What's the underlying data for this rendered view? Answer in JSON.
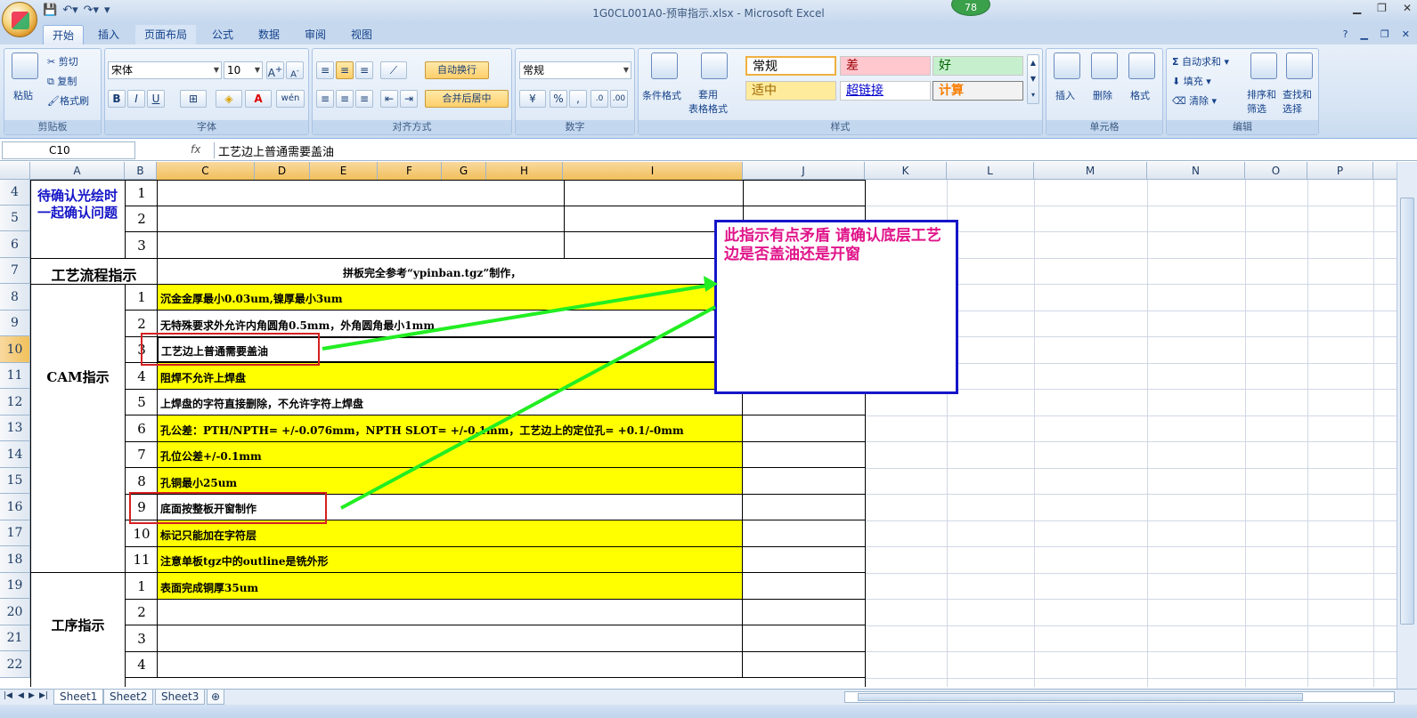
{
  "window": {
    "title": "1G0CL001A0-预审指示.xlsx - Microsoft Excel",
    "badge": "78"
  },
  "tabs": [
    "开始",
    "插入",
    "页面布局",
    "公式",
    "数据",
    "审阅",
    "视图"
  ],
  "ribbon": {
    "clipboard": {
      "paste": "粘贴",
      "cut": "剪切",
      "copy": "复制",
      "format_painter": "格式刷",
      "label": "剪贴板"
    },
    "font": {
      "name": "宋体",
      "size": "10",
      "bold": "B",
      "italic": "I",
      "underline": "U",
      "label": "字体"
    },
    "alignment": {
      "wrap": "自动换行",
      "merge": "合并后居中",
      "label": "对齐方式"
    },
    "number": {
      "format": "常规",
      "label": "数字"
    },
    "styles": {
      "conditional": "条件格式",
      "table_format": "套用\n表格格式",
      "cells": [
        "常规",
        "差",
        "好",
        "适中",
        "超链接",
        "计算"
      ],
      "label": "样式"
    },
    "cells_group": {
      "insert": "插入",
      "delete": "删除",
      "format": "格式",
      "label": "单元格"
    },
    "editing": {
      "autosum": "自动求和",
      "fill": "填充",
      "clear": "清除",
      "sort": "排序和\n筛选",
      "find": "查找和\n选择",
      "label": "编辑"
    }
  },
  "formula_bar": {
    "name_box": "C10",
    "fx": "fx",
    "content": "工艺边上普通需要盖油"
  },
  "columns": [
    "A",
    "B",
    "C",
    "D",
    "E",
    "F",
    "G",
    "H",
    "I",
    "J",
    "K",
    "L",
    "M",
    "N",
    "O",
    "P"
  ],
  "rows": [
    "4",
    "5",
    "6",
    "7",
    "8",
    "9",
    "10",
    "11",
    "12",
    "13",
    "14",
    "15",
    "16",
    "17",
    "18",
    "19",
    "20",
    "21",
    "22"
  ],
  "sheet": {
    "confirm_header": "待确认光绘时一起确认问题",
    "process_header": "工艺流程指示",
    "process_text": "拼板完全参考“ypinban.tgz”制作，",
    "cam_header": "CAM指示",
    "procedure_header": "工序指示",
    "confirm_nums": [
      "1",
      "2",
      "3"
    ],
    "cam_items": [
      {
        "n": "1",
        "text": "沉金金厚最小0.03um,镍厚最小3um"
      },
      {
        "n": "2",
        "text": "无特殊要求外允许内角圆角0.5mm，外角圆角最小1mm"
      },
      {
        "n": "3",
        "text": "工艺边上普通需要盖油"
      },
      {
        "n": "4",
        "text": "阻焊不允许上焊盘"
      },
      {
        "n": "5",
        "text": "上焊盘的字符直接删除，不允许字符上焊盘"
      },
      {
        "n": "6",
        "text": "孔公差：PTH/NPTH= +/-0.076mm，NPTH SLOT= +/-0.1mm，工艺边上的定位孔= +0.1/-0mm"
      },
      {
        "n": "7",
        "text": "孔位公差+/-0.1mm"
      },
      {
        "n": "8",
        "text": "孔铜最小25um"
      },
      {
        "n": "9",
        "text": "底面按整板开窗制作"
      },
      {
        "n": "10",
        "text": "标记只能加在字符层"
      },
      {
        "n": "11",
        "text": "注意单板tgz中的outline是铣外形"
      }
    ],
    "procedure_items": [
      {
        "n": "1",
        "text": "表面完成铜厚35um"
      },
      {
        "n": "2",
        "text": ""
      },
      {
        "n": "3",
        "text": ""
      },
      {
        "n": "4",
        "text": ""
      }
    ]
  },
  "annotation": {
    "text": "此指示有点矛盾   请确认底层工艺边是否盖油还是开窗"
  },
  "sheet_tabs": [
    "Sheet1",
    "Sheet2",
    "Sheet3"
  ],
  "colors": {
    "highlight": "#ffff00",
    "note_text": "#e0148a",
    "note_border": "#1515c8",
    "arrow": "#22ee22",
    "red_box": "#d42020"
  }
}
